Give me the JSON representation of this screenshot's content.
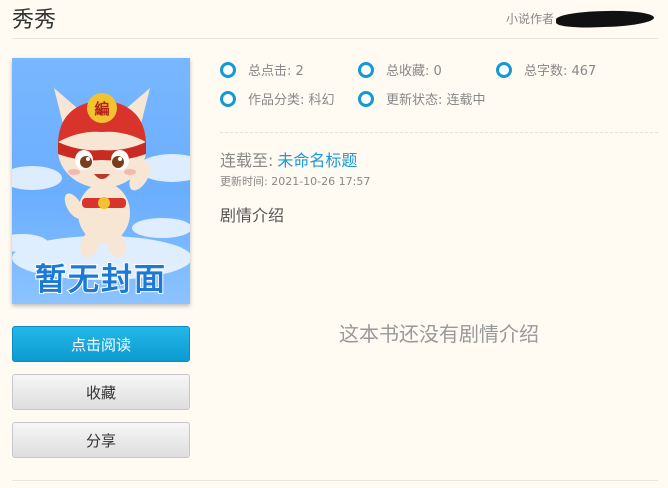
{
  "book": {
    "title": "秀秀",
    "author_label": "小说作者"
  },
  "cover": {
    "text": "暂无封面",
    "mascot_badge": "編"
  },
  "actions": {
    "read": "点击阅读",
    "favorite": "收藏",
    "share": "分享"
  },
  "stats": {
    "clicks": "总点击: 2",
    "favorites": "总收藏: 0",
    "words": "总字数: 467",
    "category": "作品分类: 科幻",
    "status": "更新状态: 连载中"
  },
  "serial": {
    "label": "连载至:",
    "chapter": "未命名标题",
    "update_time": "更新时间: 2021-10-26 17:57"
  },
  "synopsis": {
    "title": "剧情介绍",
    "empty_text": "这本书还没有剧情介绍"
  },
  "colors": {
    "accent": "#139ad6",
    "link": "#1a9ad6",
    "background": "#fffaf2"
  }
}
